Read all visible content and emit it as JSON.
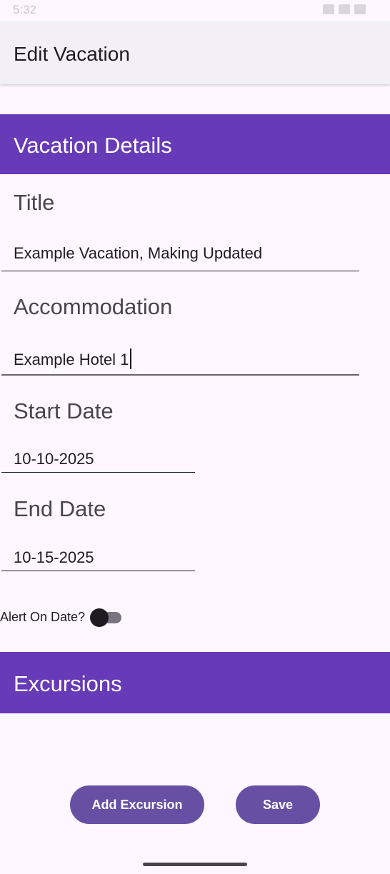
{
  "status_bar": {
    "time": "5:32"
  },
  "app_bar": {
    "title": "Edit Vacation"
  },
  "details_section": {
    "title": "Vacation Details"
  },
  "fields": {
    "title": {
      "label": "Title",
      "value": "Example Vacation, Making Updated"
    },
    "accommodation": {
      "label": "Accommodation",
      "value": "Example Hotel 1"
    },
    "start_date": {
      "label": "Start Date",
      "value": "10-10-2025"
    },
    "end_date": {
      "label": "End Date",
      "value": "10-15-2025"
    }
  },
  "alert": {
    "label": "Alert On Date?",
    "enabled": false
  },
  "excursions_section": {
    "title": "Excursions"
  },
  "buttons": {
    "add_excursion": "Add Excursion",
    "save": "Save"
  },
  "colors": {
    "primary": "#673AB7",
    "button": "#6750A4",
    "background": "#FEF7FF",
    "app_bar": "#F3EFF6"
  }
}
